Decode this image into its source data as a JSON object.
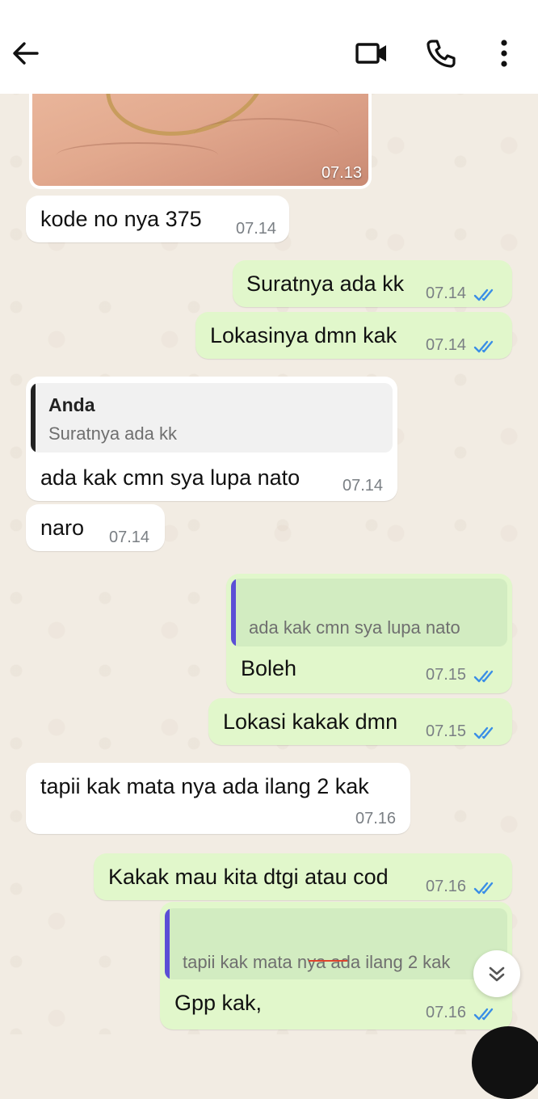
{
  "header": {
    "back_icon": "arrow-left-icon",
    "video_icon": "video-call-icon",
    "call_icon": "phone-icon",
    "more_icon": "more-vertical-icon"
  },
  "messages": [
    {
      "type": "image",
      "direction": "in",
      "time": "07.13"
    },
    {
      "type": "text",
      "direction": "in",
      "text": "kode no nya 375",
      "time": "07.14"
    },
    {
      "type": "text",
      "direction": "out",
      "text": "Suratnya ada kk",
      "time": "07.14",
      "read": true
    },
    {
      "type": "text",
      "direction": "out",
      "text": "Lokasinya dmn kak",
      "time": "07.14",
      "read": true
    },
    {
      "type": "reply",
      "direction": "in",
      "quote_name": "Anda",
      "quote_text": "Suratnya ada kk",
      "text": "ada kak cmn sya lupa nato",
      "time": "07.14"
    },
    {
      "type": "text",
      "direction": "in",
      "text": "naro",
      "time": "07.14"
    },
    {
      "type": "reply",
      "direction": "out",
      "quote_text": "ada kak cmn sya lupa nato",
      "text": "Boleh",
      "time": "07.15",
      "read": true
    },
    {
      "type": "text",
      "direction": "out",
      "text": "Lokasi kakak dmn",
      "time": "07.15",
      "read": true
    },
    {
      "type": "text",
      "direction": "in",
      "text": "tapii kak mata nya ada ilang 2 kak",
      "time": "07.16"
    },
    {
      "type": "text",
      "direction": "out",
      "text": "Kakak mau kita dtgi atau cod",
      "time": "07.16",
      "read": true
    },
    {
      "type": "reply",
      "direction": "out",
      "quote_text": "tapii kak mata nya ada ilang 2 kak",
      "text": "Gpp kak,",
      "time": "07.16",
      "read": true
    }
  ],
  "scroll_button_icon": "double-chevron-down-icon",
  "colors": {
    "incoming_bubble": "#ffffff",
    "outgoing_bubble": "#e1f7cb",
    "read_ticks": "#3a8ee6",
    "reply_bar_in": "#222222",
    "reply_bar_out": "#5b4fd6",
    "wallpaper": "#f2ece3"
  }
}
